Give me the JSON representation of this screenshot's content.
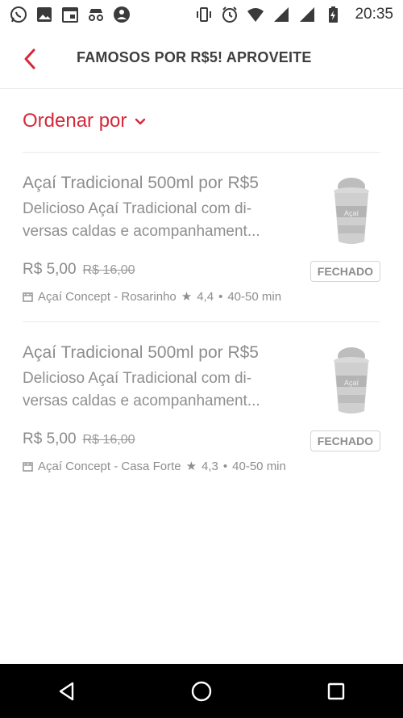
{
  "status_bar": {
    "time": "20:35",
    "left_icons": [
      "whatsapp-icon",
      "image-icon",
      "calendar-icon",
      "incognito-icon",
      "browser-icon"
    ],
    "right_icons": [
      "vibrate-icon",
      "alarm-icon",
      "wifi-icon",
      "signal-icon",
      "signal-icon",
      "battery-charging-icon"
    ]
  },
  "header": {
    "title": "FAMOSOS POR R$5! APROVEITE",
    "back_icon": "chevron-left-icon"
  },
  "sort": {
    "label": "Ordenar por",
    "icon": "chevron-down-icon"
  },
  "items": [
    {
      "title": "Açaí Tradicional 500ml por R$5",
      "desc_line1": "Delicioso Açaí Tradicional com di-",
      "desc_line2": "versas caldas e acompanhament...",
      "price": "R$ 5,00",
      "old_price": "R$ 16,00",
      "status": "FECHADO",
      "store": "Açaí Concept - Rosarinho",
      "rating": "4,4",
      "time": "40-50 min"
    },
    {
      "title": "Açaí Tradicional 500ml por R$5",
      "desc_line1": "Delicioso Açaí Tradicional com di-",
      "desc_line2": "versas caldas e acompanhament...",
      "price": "R$ 5,00",
      "old_price": "R$ 16,00",
      "status": "FECHADO",
      "store": "Açaí Concept - Casa Forte",
      "rating": "4,3",
      "time": "40-50 min"
    }
  ],
  "meta_separators": {
    "star": "★",
    "dot": "•"
  },
  "navbar": {
    "icons": [
      "back-triangle-icon",
      "home-circle-icon",
      "recents-square-icon"
    ]
  },
  "colors": {
    "accent": "#d6283b",
    "text_muted": "#8d8d8d",
    "title": "#3f3e3e"
  }
}
